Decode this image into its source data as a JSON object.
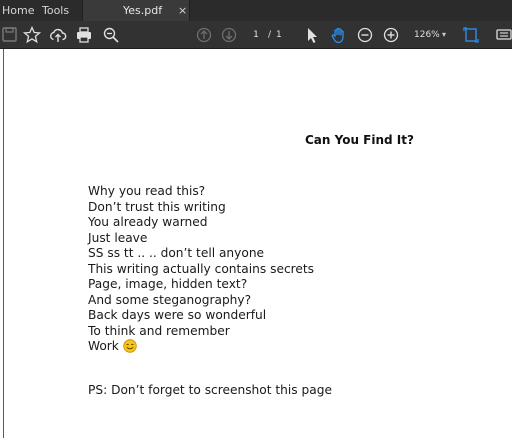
{
  "menubar": {
    "home_label": "Home",
    "tools_label": "Tools",
    "tab_title": "Yes.pdf",
    "tab_close": "×"
  },
  "toolbar": {
    "page_current": "1",
    "page_separator": "/",
    "page_total": "1",
    "zoom_level": "126%",
    "zoom_caret": "▾",
    "icons": [
      "save-icon",
      "bookmark-star-icon",
      "upload-cloud-icon",
      "print-icon",
      "zoom-out-search-icon",
      "prev-page-icon",
      "next-page-icon",
      "select-cursor-icon",
      "hand-tool-icon",
      "zoom-out-icon",
      "zoom-in-icon",
      "fit-page-icon",
      "read-mode-icon"
    ],
    "accent_color": "#2d8ceb"
  },
  "document": {
    "title": "Can You Find It?",
    "lines": [
      "Why you read this?",
      "Don’t trust this writing",
      "You already warned",
      "Just leave",
      "SS ss tt .. .. don’t tell anyone",
      "This writing actually contains secrets",
      "Page, image, hidden text?",
      "And some steganography?",
      "Back days were so wonderful",
      "To think and remember",
      "Work"
    ],
    "emoji": "smiling-face-icon",
    "postscript": "PS: Don’t forget to screenshot this page"
  }
}
